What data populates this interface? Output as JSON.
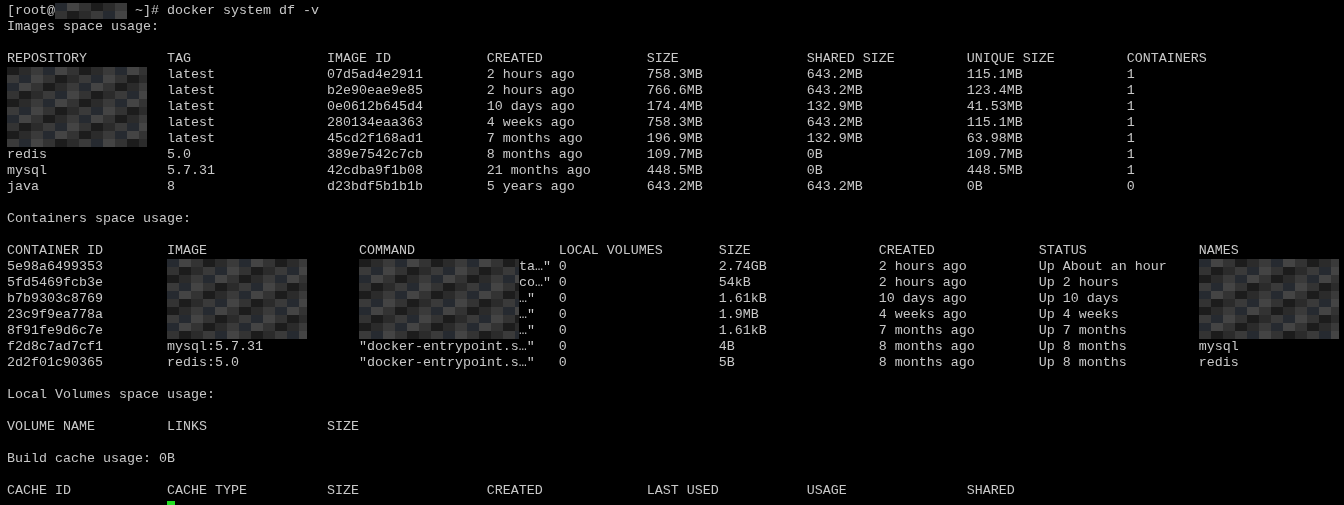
{
  "prompt": {
    "user": "[root@",
    "host": {
      "kind": "redacted"
    },
    "command": "~]# docker system df -v"
  },
  "sections": [
    {
      "heading": "Images space usage:",
      "table": {
        "columns": [
          "REPOSITORY",
          "TAG",
          "IMAGE ID",
          "CREATED",
          "SIZE",
          "SHARED SIZE",
          "UNIQUE SIZE",
          "CONTAINERS"
        ],
        "rows": [
          [
            {
              "kind": "redacted"
            },
            "latest",
            "07d5ad4e2911",
            "2 hours ago",
            "758.3MB",
            "643.2MB",
            "115.1MB",
            "1"
          ],
          [
            {
              "kind": "redacted"
            },
            "latest",
            "b2e90eae9e85",
            "2 hours ago",
            "766.6MB",
            "643.2MB",
            "123.4MB",
            "1"
          ],
          [
            {
              "kind": "redacted"
            },
            "latest",
            "0e0612b645d4",
            "10 days ago",
            "174.4MB",
            "132.9MB",
            "41.53MB",
            "1"
          ],
          [
            {
              "kind": "redacted"
            },
            "latest",
            "280134eaa363",
            "4 weeks ago",
            "758.3MB",
            "643.2MB",
            "115.1MB",
            "1"
          ],
          [
            {
              "kind": "redacted"
            },
            "latest",
            "45cd2f168ad1",
            "7 months ago",
            "196.9MB",
            "132.9MB",
            "63.98MB",
            "1"
          ],
          [
            "redis",
            "5.0",
            "389e7542c7cb",
            "8 months ago",
            "109.7MB",
            "0B",
            "109.7MB",
            "1"
          ],
          [
            "mysql",
            "5.7.31",
            "42cdba9f1b08",
            "21 months ago",
            "448.5MB",
            "0B",
            "448.5MB",
            "1"
          ],
          [
            "java",
            "8",
            "d23bdf5b1b1b",
            "5 years ago",
            "643.2MB",
            "643.2MB",
            "0B",
            "0"
          ]
        ]
      }
    },
    {
      "heading": "Containers space usage:",
      "table": {
        "columns": [
          "CONTAINER ID",
          "IMAGE",
          "COMMAND",
          "LOCAL VOLUMES",
          "SIZE",
          "CREATED",
          "STATUS",
          "NAMES"
        ],
        "rows": [
          [
            "5e98a6499353",
            {
              "kind": "redacted"
            },
            {
              "kind": "redacted",
              "tail": "ta…\""
            },
            "0",
            "2.74GB",
            "2 hours ago",
            "Up About an hour",
            {
              "kind": "redacted"
            }
          ],
          [
            "5fd5469fcb3e",
            {
              "kind": "redacted"
            },
            {
              "kind": "redacted",
              "tail": "co…\""
            },
            "0",
            "54kB",
            "2 hours ago",
            "Up 2 hours",
            {
              "kind": "redacted"
            }
          ],
          [
            "b7b9303c8769",
            {
              "kind": "redacted"
            },
            {
              "kind": "redacted",
              "tail": "…\""
            },
            "0",
            "1.61kB",
            "10 days ago",
            "Up 10 days",
            {
              "kind": "redacted"
            }
          ],
          [
            "23c9f9ea778a",
            {
              "kind": "redacted"
            },
            {
              "kind": "redacted",
              "tail": "…\""
            },
            "0",
            "1.9MB",
            "4 weeks ago",
            "Up 4 weeks",
            {
              "kind": "redacted"
            }
          ],
          [
            "8f91fe9d6c7e",
            {
              "kind": "redacted"
            },
            {
              "kind": "redacted",
              "tail": "…\""
            },
            "0",
            "1.61kB",
            "7 months ago",
            "Up 7 months",
            {
              "kind": "redacted"
            }
          ],
          [
            "f2d8c7ad7cf1",
            "mysql:5.7.31",
            "\"docker-entrypoint.s…\"",
            "0",
            "4B",
            "8 months ago",
            "Up 8 months",
            "mysql"
          ],
          [
            "2d2f01c90365",
            "redis:5.0",
            "\"docker-entrypoint.s…\"",
            "0",
            "5B",
            "8 months ago",
            "Up 8 months",
            "redis"
          ]
        ]
      }
    },
    {
      "heading": "Local Volumes space usage:",
      "table": {
        "columns": [
          "VOLUME NAME",
          "LINKS",
          "SIZE"
        ]
      }
    },
    {
      "heading": "Build cache usage: 0B",
      "table": {
        "columns": [
          "CACHE ID",
          "CACHE TYPE",
          "SIZE",
          "CREATED",
          "LAST USED",
          "USAGE",
          "SHARED"
        ]
      }
    }
  ]
}
